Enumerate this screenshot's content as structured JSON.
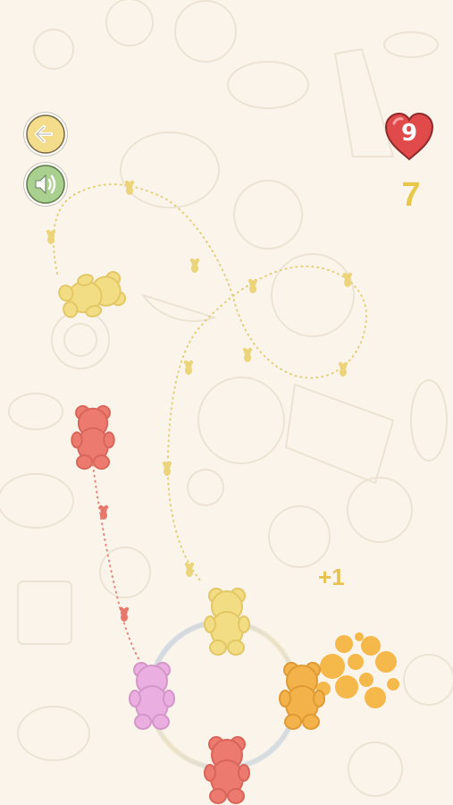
{
  "hud": {
    "lives": "9",
    "score": "7",
    "plus_popup": "+1"
  },
  "buttons": {
    "back_icon": "arrow-left-icon",
    "sound_icon": "speaker-icon"
  },
  "colors": {
    "background": "#fbf4ea",
    "heart": "#e14a4a",
    "score": "#e7c84a",
    "button_yellow": "#f3dc8a",
    "button_green": "#a9d08e",
    "yellow_bear": "#f2dc84",
    "red_bear": "#ec7a6e",
    "pink_bear": "#eaaee0",
    "orange_bear": "#f4b24a"
  },
  "bears": [
    {
      "color": "yellow",
      "state": "moving"
    },
    {
      "color": "red",
      "state": "moving"
    },
    {
      "color": "yellow",
      "state": "ring"
    },
    {
      "color": "pink",
      "state": "ring"
    },
    {
      "color": "orange",
      "state": "ring"
    },
    {
      "color": "red",
      "state": "ring"
    }
  ]
}
